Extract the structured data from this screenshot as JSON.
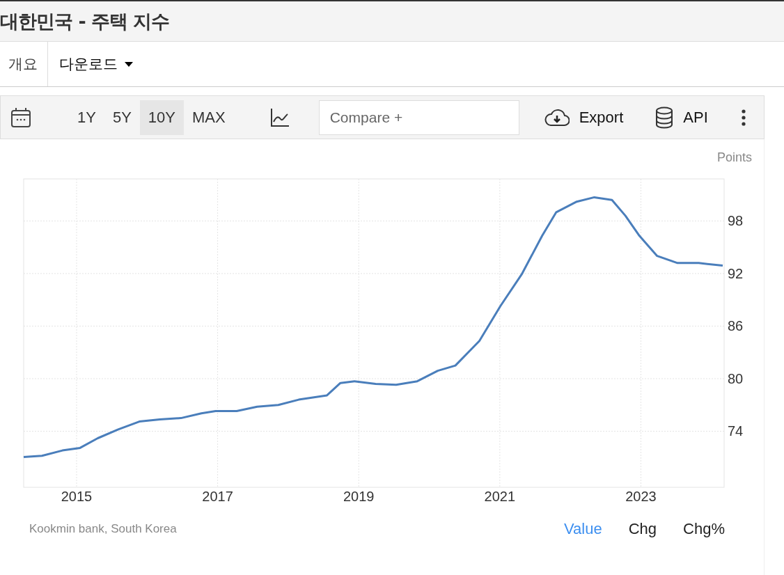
{
  "title": "대한민국 - 주택 지수",
  "tabs": [
    {
      "label": "개요",
      "selected": false,
      "kind": "link"
    },
    {
      "label": "다운로드",
      "selected": false,
      "kind": "dropdown"
    }
  ],
  "toolbar": {
    "ranges": [
      {
        "label": "1Y",
        "selected": false
      },
      {
        "label": "5Y",
        "selected": false
      },
      {
        "label": "10Y",
        "selected": true
      },
      {
        "label": "MAX",
        "selected": false
      }
    ],
    "compare_placeholder": "Compare +",
    "export": "Export",
    "api": "API"
  },
  "chart_data": {
    "type": "line",
    "ylabel": "Points",
    "xlim": [
      2014.25,
      2024.18
    ],
    "ylim": [
      67.6,
      102.8
    ],
    "xticks": [
      2015,
      2017,
      2019,
      2021,
      2023
    ],
    "yticks": [
      74,
      80,
      86,
      92,
      98
    ],
    "x": [
      2014.25,
      2014.51,
      2014.8,
      2015.05,
      2015.3,
      2015.59,
      2015.89,
      2016.18,
      2016.48,
      2016.77,
      2016.97,
      2017.27,
      2017.56,
      2017.86,
      2018.15,
      2018.55,
      2018.74,
      2018.94,
      2019.24,
      2019.53,
      2019.83,
      2020.12,
      2020.37,
      2020.71,
      2021.01,
      2021.31,
      2021.6,
      2021.8,
      2022.09,
      2022.34,
      2022.59,
      2022.78,
      2022.98,
      2023.23,
      2023.52,
      2023.82,
      2024.16
    ],
    "grid": true,
    "series": [
      {
        "color": "#4a7ebb",
        "values": [
          71.05,
          71.2,
          71.8,
          72.1,
          73.2,
          74.2,
          75.1,
          75.35,
          75.5,
          76.05,
          76.3,
          76.3,
          76.8,
          77.0,
          77.6,
          78.1,
          79.5,
          79.7,
          79.4,
          79.3,
          79.7,
          80.9,
          81.5,
          84.3,
          88.3,
          91.9,
          96.3,
          99.0,
          100.2,
          100.7,
          100.4,
          98.6,
          96.3,
          94.0,
          93.2,
          93.2,
          92.9
        ]
      }
    ]
  },
  "source": "Kookmin bank, South Korea",
  "views": [
    {
      "label": "Value",
      "selected": true
    },
    {
      "label": "Chg",
      "selected": false
    },
    {
      "label": "Chg%",
      "selected": false
    }
  ]
}
